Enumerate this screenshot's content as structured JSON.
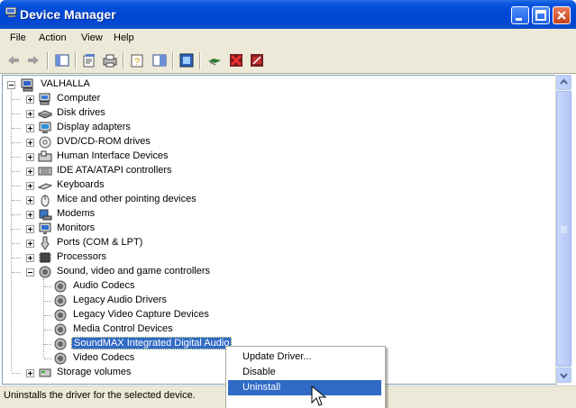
{
  "window": {
    "title": "Device Manager",
    "buttons": [
      "minimize",
      "maximize",
      "close"
    ]
  },
  "menubar": {
    "items": [
      "File",
      "Action",
      "View",
      "Help"
    ]
  },
  "toolbar": {
    "icons": [
      "back-arrow-icon",
      "forward-arrow-icon",
      "show-hide-console-tree-icon",
      "properties-icon",
      "print-icon",
      "help-icon",
      "console-tree-icon",
      "scan-hardware-icon",
      "update-driver-icon",
      "uninstall-icon",
      "disable-icon"
    ]
  },
  "tree": {
    "root": "VALHALLA",
    "categories": [
      {
        "label": "Computer",
        "icon": "computer-icon",
        "expanded": false
      },
      {
        "label": "Disk drives",
        "icon": "disk-drive-icon",
        "expanded": false
      },
      {
        "label": "Display adapters",
        "icon": "display-adapter-icon",
        "expanded": false
      },
      {
        "label": "DVD/CD-ROM drives",
        "icon": "cdrom-icon",
        "expanded": false
      },
      {
        "label": "Human Interface Devices",
        "icon": "hid-icon",
        "expanded": false
      },
      {
        "label": "IDE ATA/ATAPI controllers",
        "icon": "ide-controller-icon",
        "expanded": false
      },
      {
        "label": "Keyboards",
        "icon": "keyboard-icon",
        "expanded": false
      },
      {
        "label": "Mice and other pointing devices",
        "icon": "mouse-icon",
        "expanded": false
      },
      {
        "label": "Modems",
        "icon": "modem-icon",
        "expanded": false
      },
      {
        "label": "Monitors",
        "icon": "monitor-icon",
        "expanded": false
      },
      {
        "label": "Ports (COM & LPT)",
        "icon": "port-icon",
        "expanded": false
      },
      {
        "label": "Processors",
        "icon": "processor-icon",
        "expanded": false
      },
      {
        "label": "Sound, video and game controllers",
        "icon": "sound-icon",
        "expanded": true
      },
      {
        "label": "Storage volumes",
        "icon": "storage-icon",
        "expanded": false
      }
    ],
    "sound_children": [
      "Audio Codecs",
      "Legacy Audio Drivers",
      "Legacy Video Capture Devices",
      "Media Control Devices",
      "SoundMAX Integrated Digital Audio",
      "Video Codecs"
    ],
    "selected": "SoundMAX Integrated Digital Audio"
  },
  "context_menu": {
    "items": [
      "Update Driver...",
      "Disable",
      "Uninstall"
    ],
    "highlighted": "Uninstall"
  },
  "statusbar": {
    "text": "Uninstalls the driver for the selected device."
  },
  "colors": {
    "titlebar": "#0047d3",
    "selection": "#316ac5",
    "chrome": "#ece9d8"
  }
}
